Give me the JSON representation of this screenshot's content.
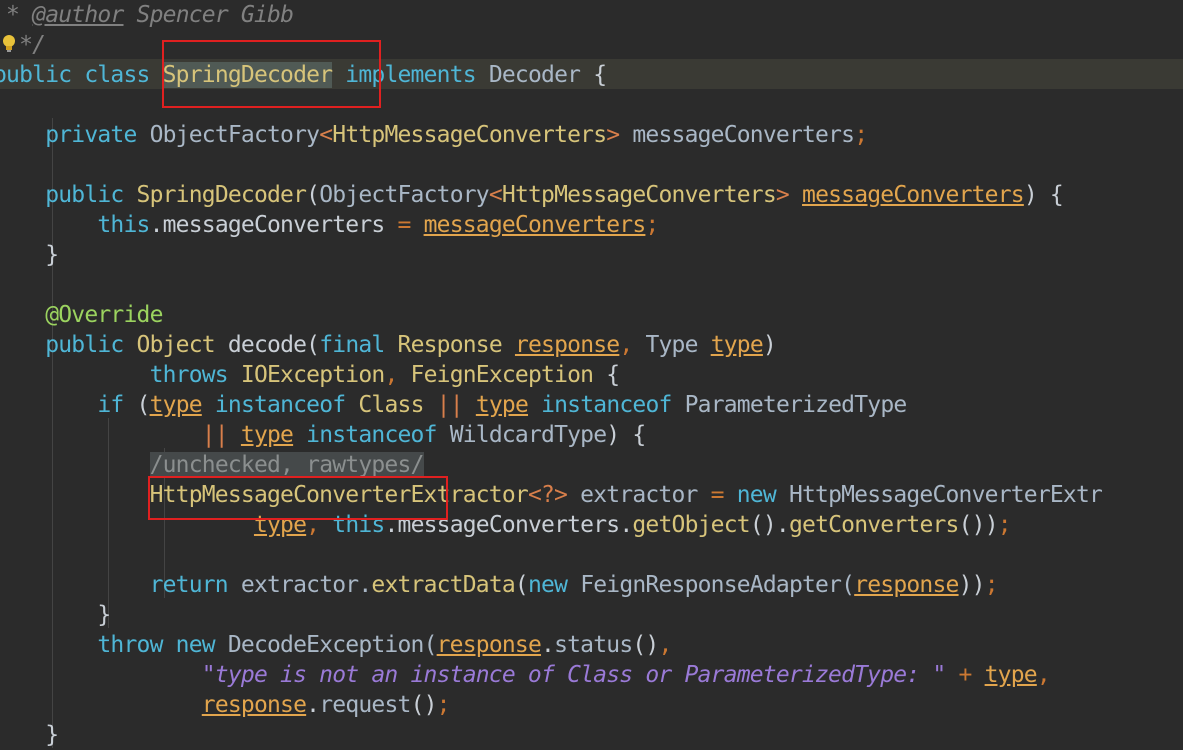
{
  "colors": {
    "background": "#2b2b2b",
    "caret_line": "#3a3a34",
    "keyword": "#4fb6d6",
    "type": "#d7c47a",
    "parameter": "#e2a54d",
    "string": "#9a7ad7",
    "annotation": "#9bd35f",
    "comment": "#808080",
    "highlight_box": "#e02020"
  },
  "icons": {
    "intention_bulb": "lightbulb-icon"
  },
  "code": [
    [
      [
        "c-comment",
        " * "
      ],
      [
        "c-doctag",
        "@author"
      ],
      [
        "c-comment",
        " Spencer Gibb"
      ]
    ],
    [
      [
        "c-comment",
        "  */"
      ]
    ],
    [
      [
        "c-kw",
        "public class "
      ],
      [
        "c-type hl-word",
        "SpringDecoder"
      ],
      [
        "c-kw",
        " implements"
      ],
      [
        "c-field",
        " Decoder "
      ],
      [
        "c-plain",
        "{"
      ]
    ],
    [],
    [
      [
        "c-kw",
        "    private "
      ],
      [
        "c-field",
        "ObjectFactory"
      ],
      [
        "c-gen",
        "<"
      ],
      [
        "c-type",
        "HttpMessageConverters"
      ],
      [
        "c-gen",
        ">"
      ],
      [
        "c-field",
        " messageConverters"
      ],
      [
        "c-punct",
        ";"
      ]
    ],
    [],
    [
      [
        "c-kw",
        "    public "
      ],
      [
        "c-type",
        "SpringDecoder"
      ],
      [
        "c-plain",
        "("
      ],
      [
        "c-field",
        "ObjectFactory"
      ],
      [
        "c-gen",
        "<"
      ],
      [
        "c-type",
        "HttpMessageConverters"
      ],
      [
        "c-gen",
        "> "
      ],
      [
        "c-param",
        "messageConverters"
      ],
      [
        "c-plain",
        ") {"
      ]
    ],
    [
      [
        "c-kw",
        "        this"
      ],
      [
        "c-plain",
        ".messageConverters "
      ],
      [
        "c-punct",
        "= "
      ],
      [
        "c-param",
        "messageConverters"
      ],
      [
        "c-punct",
        ";"
      ]
    ],
    [
      [
        "c-plain",
        "    }"
      ]
    ],
    [],
    [
      [
        "c-ann",
        "    @Override"
      ]
    ],
    [
      [
        "c-kw",
        "    public "
      ],
      [
        "c-type",
        "Object"
      ],
      [
        "c-plain",
        " decode("
      ],
      [
        "c-kw",
        "final "
      ],
      [
        "c-type",
        "Response "
      ],
      [
        "c-param",
        "response"
      ],
      [
        "c-punct",
        ", "
      ],
      [
        "c-field",
        "Type "
      ],
      [
        "c-param",
        "type"
      ],
      [
        "c-plain",
        ")"
      ]
    ],
    [
      [
        "c-kw",
        "            throws "
      ],
      [
        "c-type",
        "IOException"
      ],
      [
        "c-punct",
        ", "
      ],
      [
        "c-type",
        "FeignException "
      ],
      [
        "c-plain",
        "{"
      ]
    ],
    [
      [
        "c-kw",
        "        if "
      ],
      [
        "c-plain",
        "("
      ],
      [
        "c-param",
        "type"
      ],
      [
        "c-kw",
        " instanceof "
      ],
      [
        "c-type",
        "Class "
      ],
      [
        "c-gen",
        "|| "
      ],
      [
        "c-param",
        "type"
      ],
      [
        "c-kw",
        " instanceof "
      ],
      [
        "c-field",
        "ParameterizedType"
      ]
    ],
    [
      [
        "c-gen",
        "                || "
      ],
      [
        "c-param",
        "type"
      ],
      [
        "c-kw",
        " instanceof "
      ],
      [
        "c-field",
        "WildcardType"
      ],
      [
        "c-plain",
        ") {"
      ]
    ],
    [
      [
        "c-plain",
        "            "
      ],
      [
        "c-suppress",
        "/unchecked, rawtypes/"
      ]
    ],
    [
      [
        "c-type",
        "            HttpMessageConverterExtractor"
      ],
      [
        "c-gen",
        "<?>"
      ],
      [
        "c-field",
        " extractor "
      ],
      [
        "c-punct",
        "= "
      ],
      [
        "c-kw",
        "new "
      ],
      [
        "c-field",
        "HttpMessageConverterExtr"
      ]
    ],
    [
      [
        "c-plain",
        "                    "
      ],
      [
        "c-param",
        "type"
      ],
      [
        "c-punct",
        ", "
      ],
      [
        "c-kw",
        "this"
      ],
      [
        "c-plain",
        ".messageConverters."
      ],
      [
        "c-method",
        "getObject"
      ],
      [
        "c-plain",
        "()."
      ],
      [
        "c-method",
        "getConverters"
      ],
      [
        "c-plain",
        "())"
      ],
      [
        "c-punct",
        ";"
      ]
    ],
    [],
    [
      [
        "c-kw",
        "            return "
      ],
      [
        "c-field",
        "extractor."
      ],
      [
        "c-method",
        "extractData"
      ],
      [
        "c-plain",
        "("
      ],
      [
        "c-kw",
        "new "
      ],
      [
        "c-field",
        "FeignResponseAdapter("
      ],
      [
        "c-param",
        "response"
      ],
      [
        "c-plain",
        "))"
      ],
      [
        "c-punct",
        ";"
      ]
    ],
    [
      [
        "c-plain",
        "        }"
      ]
    ],
    [
      [
        "c-kw",
        "        throw new "
      ],
      [
        "c-field",
        "DecodeException("
      ],
      [
        "c-param",
        "response"
      ],
      [
        "c-plain",
        "."
      ],
      [
        "c-field",
        "status"
      ],
      [
        "c-plain",
        "()"
      ],
      [
        "c-punct",
        ","
      ]
    ],
    [
      [
        "c-str",
        "                \"type is not an instance of Class or ParameterizedType: \" "
      ],
      [
        "c-punct",
        "+ "
      ],
      [
        "c-param",
        "type"
      ],
      [
        "c-punct",
        ","
      ]
    ],
    [
      [
        "c-plain",
        "                "
      ],
      [
        "c-param",
        "response"
      ],
      [
        "c-plain",
        "."
      ],
      [
        "c-field",
        "request"
      ],
      [
        "c-plain",
        "()"
      ],
      [
        "c-punct",
        ";"
      ]
    ],
    [
      [
        "c-plain",
        "    }"
      ]
    ]
  ]
}
